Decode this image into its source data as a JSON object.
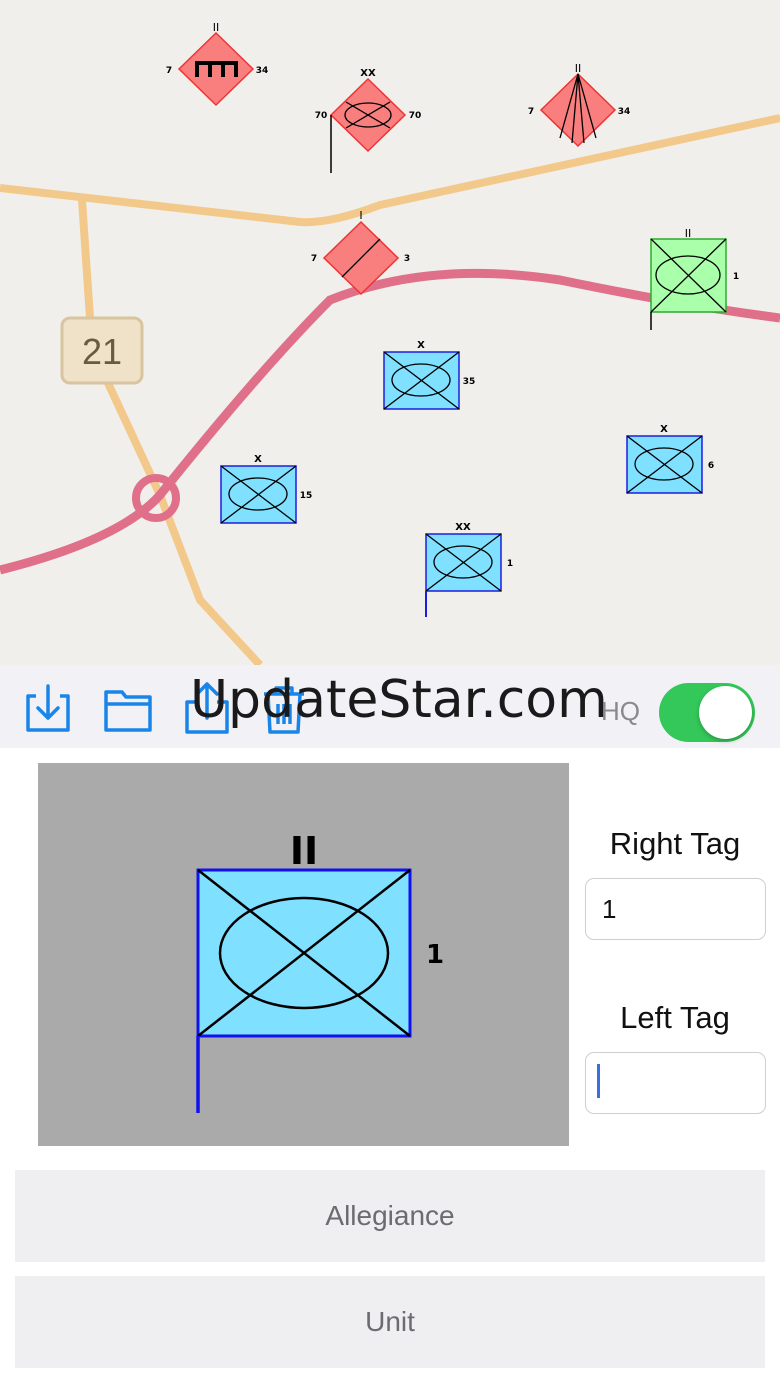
{
  "map": {
    "route_shield": "21",
    "units": [
      {
        "name": "red-unit-1",
        "echelon": "II",
        "left": "7",
        "right": "34",
        "symbol": "engineer"
      },
      {
        "name": "red-unit-2",
        "echelon": "XX",
        "left": "70",
        "right": "70",
        "symbol": "armor"
      },
      {
        "name": "red-unit-3",
        "echelon": "II",
        "left": "7",
        "right": "34",
        "symbol": "signal"
      },
      {
        "name": "red-unit-4",
        "echelon": "I",
        "left": "7",
        "right": "3",
        "symbol": "infantry"
      },
      {
        "name": "green-unit",
        "echelon": "II",
        "left": "",
        "right": "1",
        "symbol": "armored-infantry"
      },
      {
        "name": "blue-unit-1",
        "echelon": "X",
        "left": "",
        "right": "35",
        "symbol": "armored-infantry"
      },
      {
        "name": "blue-unit-2",
        "echelon": "X",
        "left": "",
        "right": "6",
        "symbol": "armored-infantry"
      },
      {
        "name": "blue-unit-3",
        "echelon": "X",
        "left": "",
        "right": "15",
        "symbol": "armored-infantry"
      },
      {
        "name": "blue-unit-4",
        "echelon": "XX",
        "left": "",
        "right": "1",
        "symbol": "armored-infantry"
      }
    ]
  },
  "toolbar": {
    "icons": [
      "download-icon",
      "folder-icon",
      "share-icon",
      "trash-icon"
    ],
    "watermark": "UpdateStar.com",
    "hq_label": "HQ",
    "hq_on": true
  },
  "preview": {
    "echelon": "II",
    "right_tag": "1"
  },
  "tags": {
    "right_label": "Right Tag",
    "right_value": "1",
    "left_label": "Left Tag",
    "left_value": ""
  },
  "buttons": {
    "allegiance": "Allegiance",
    "unit": "Unit"
  },
  "colors": {
    "hostile": "#f97f7f",
    "friendly": "#80e0ff",
    "neutral": "#aaffaa",
    "toggle_on": "#34c759",
    "accent": "#1a85e8"
  }
}
